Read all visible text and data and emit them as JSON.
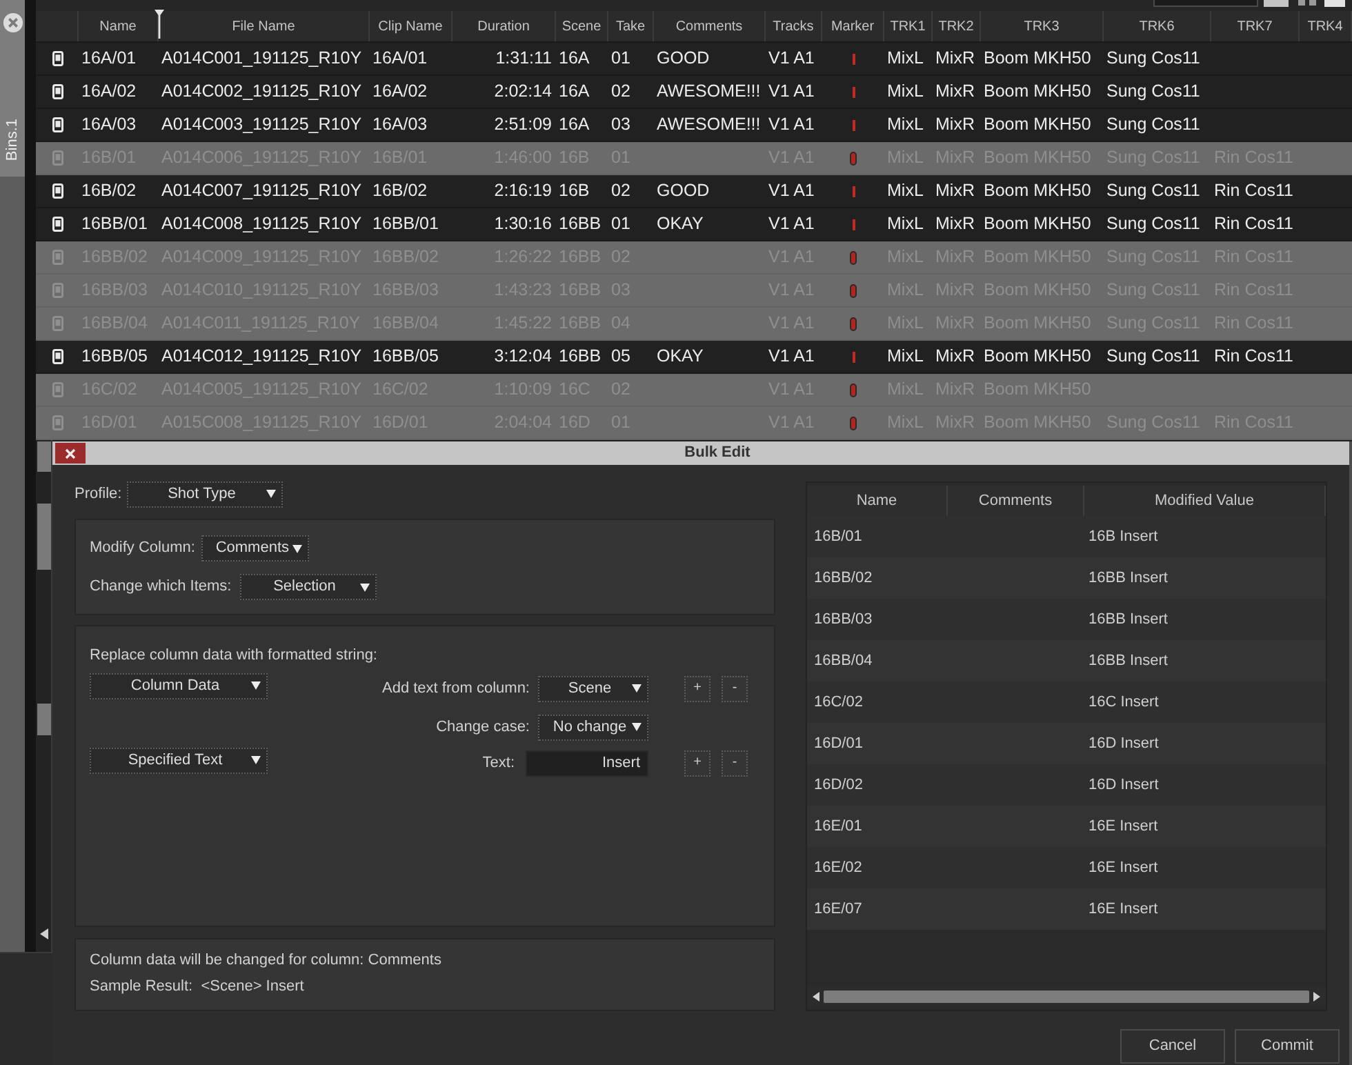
{
  "bins_tab": {
    "label": "Bins.1"
  },
  "table": {
    "columns": [
      "Name",
      "File Name",
      "Clip Name",
      "Duration",
      "Scene",
      "Take",
      "Comments",
      "Tracks",
      "Marker",
      "TRK1",
      "TRK2",
      "TRK3",
      "TRK6",
      "TRK7",
      "TRK4"
    ],
    "rows": [
      {
        "name": "16A/01",
        "file_name": "A014C001_191125_R10Y",
        "clip_name": "16A/01",
        "duration": "1:31:11",
        "scene": "16A",
        "take": "01",
        "comments": "GOOD",
        "tracks": "V1 A1",
        "trk1": "MixL",
        "trk2": "MixR",
        "trk3": "Boom MKH50",
        "trk6": "Sung Cos11",
        "selected": false
      },
      {
        "name": "16A/02",
        "file_name": "A014C002_191125_R10Y",
        "clip_name": "16A/02",
        "duration": "2:02:14",
        "scene": "16A",
        "take": "02",
        "comments": "AWESOME!!!",
        "tracks": "V1 A1",
        "trk1": "MixL",
        "trk2": "MixR",
        "trk3": "Boom MKH50",
        "trk6": "Sung Cos11",
        "selected": false
      },
      {
        "name": "16A/03",
        "file_name": "A014C003_191125_R10Y",
        "clip_name": "16A/03",
        "duration": "2:51:09",
        "scene": "16A",
        "take": "03",
        "comments": "AWESOME!!!",
        "tracks": "V1 A1",
        "trk1": "MixL",
        "trk2": "MixR",
        "trk3": "Boom MKH50",
        "trk6": "Sung Cos11",
        "selected": false
      },
      {
        "name": "16B/01",
        "file_name": "A014C006_191125_R10Y",
        "clip_name": "16B/01",
        "duration": "1:46:00",
        "scene": "16B",
        "take": "01",
        "tracks": "V1 A1",
        "trk1": "MixL",
        "trk2": "MixR",
        "trk3": "Boom MKH50",
        "trk6": "Sung Cos11",
        "trk7": "Rin Cos11",
        "selected": true
      },
      {
        "name": "16B/02",
        "file_name": "A014C007_191125_R10Y",
        "clip_name": "16B/02",
        "duration": "2:16:19",
        "scene": "16B",
        "take": "02",
        "comments": "GOOD",
        "tracks": "V1 A1",
        "trk1": "MixL",
        "trk2": "MixR",
        "trk3": "Boom MKH50",
        "trk6": "Sung Cos11",
        "trk7": "Rin Cos11",
        "selected": false
      },
      {
        "name": "16BB/01",
        "file_name": "A014C008_191125_R10Y",
        "clip_name": "16BB/01",
        "duration": "1:30:16",
        "scene": "16BB",
        "take": "01",
        "comments": "OKAY",
        "tracks": "V1 A1",
        "trk1": "MixL",
        "trk2": "MixR",
        "trk3": "Boom MKH50",
        "trk6": "Sung Cos11",
        "trk7": "Rin Cos11",
        "selected": false
      },
      {
        "name": "16BB/02",
        "file_name": "A014C009_191125_R10Y",
        "clip_name": "16BB/02",
        "duration": "1:26:22",
        "scene": "16BB",
        "take": "02",
        "tracks": "V1 A1",
        "trk1": "MixL",
        "trk2": "MixR",
        "trk3": "Boom MKH50",
        "trk6": "Sung Cos11",
        "trk7": "Rin Cos11",
        "selected": true
      },
      {
        "name": "16BB/03",
        "file_name": "A014C010_191125_R10Y",
        "clip_name": "16BB/03",
        "duration": "1:43:23",
        "scene": "16BB",
        "take": "03",
        "tracks": "V1 A1",
        "trk1": "MixL",
        "trk2": "MixR",
        "trk3": "Boom MKH50",
        "trk6": "Sung Cos11",
        "trk7": "Rin Cos11",
        "selected": true
      },
      {
        "name": "16BB/04",
        "file_name": "A014C011_191125_R10Y",
        "clip_name": "16BB/04",
        "duration": "1:45:22",
        "scene": "16BB",
        "take": "04",
        "tracks": "V1 A1",
        "trk1": "MixL",
        "trk2": "MixR",
        "trk3": "Boom MKH50",
        "trk6": "Sung Cos11",
        "trk7": "Rin Cos11",
        "selected": true
      },
      {
        "name": "16BB/05",
        "file_name": "A014C012_191125_R10Y",
        "clip_name": "16BB/05",
        "duration": "3:12:04",
        "scene": "16BB",
        "take": "05",
        "comments": "OKAY",
        "tracks": "V1 A1",
        "trk1": "MixL",
        "trk2": "MixR",
        "trk3": "Boom MKH50",
        "trk6": "Sung Cos11",
        "trk7": "Rin Cos11",
        "selected": false
      },
      {
        "name": "16C/02",
        "file_name": "A014C005_191125_R10Y",
        "clip_name": "16C/02",
        "duration": "1:10:09",
        "scene": "16C",
        "take": "02",
        "tracks": "V1 A1",
        "trk1": "MixL",
        "trk2": "MixR",
        "trk3": "Boom MKH50",
        "selected": true
      },
      {
        "name": "16D/01",
        "file_name": "A015C008_191125_R10Y",
        "clip_name": "16D/01",
        "duration": "2:04:04",
        "scene": "16D",
        "take": "01",
        "tracks": "V1 A1",
        "trk1": "MixL",
        "trk2": "MixR",
        "trk3": "Boom MKH50",
        "trk6": "Sung Cos11",
        "trk7": "Rin Cos11",
        "selected": true
      }
    ]
  },
  "bulk_edit": {
    "title": "Bulk Edit",
    "profile": {
      "label": "Profile:",
      "value": "Shot Type"
    },
    "modify_column": {
      "label": "Modify Column:",
      "value": "Comments"
    },
    "change_items": {
      "label": "Change which Items:",
      "value": "Selection"
    },
    "formatted_string": {
      "heading": "Replace column data with formatted string:",
      "segments": [
        {
          "source": "Column Data",
          "fields": [
            {
              "kind": "dropdown",
              "label": "Add text from column:",
              "value": "Scene",
              "buttons": [
                "+",
                "-"
              ]
            },
            {
              "kind": "dropdown",
              "label": "Change case:",
              "value": "No change"
            }
          ]
        },
        {
          "source": "Specified Text",
          "fields": [
            {
              "kind": "input",
              "label": "Text:",
              "value": "Insert",
              "buttons": [
                "+",
                "-"
              ]
            }
          ]
        }
      ]
    },
    "summary": [
      "Column data will be changed for column: Comments",
      "Sample Result:  <Scene> Insert"
    ],
    "preview": {
      "columns": [
        "Name",
        "Comments",
        "Modified Value"
      ],
      "rows": [
        {
          "name": "16B/01",
          "modified_value": "16B Insert"
        },
        {
          "name": "16BB/02",
          "modified_value": "16BB Insert"
        },
        {
          "name": "16BB/03",
          "modified_value": "16BB Insert"
        },
        {
          "name": "16BB/04",
          "modified_value": "16BB Insert"
        },
        {
          "name": "16C/02",
          "modified_value": "16C Insert"
        },
        {
          "name": "16D/01",
          "modified_value": "16D Insert"
        },
        {
          "name": "16D/02",
          "modified_value": "16D Insert"
        },
        {
          "name": "16E/01",
          "modified_value": "16E Insert"
        },
        {
          "name": "16E/02",
          "modified_value": "16E Insert"
        },
        {
          "name": "16E/07",
          "modified_value": "16E Insert"
        }
      ]
    },
    "buttons": [
      "Cancel",
      "Commit"
    ]
  }
}
